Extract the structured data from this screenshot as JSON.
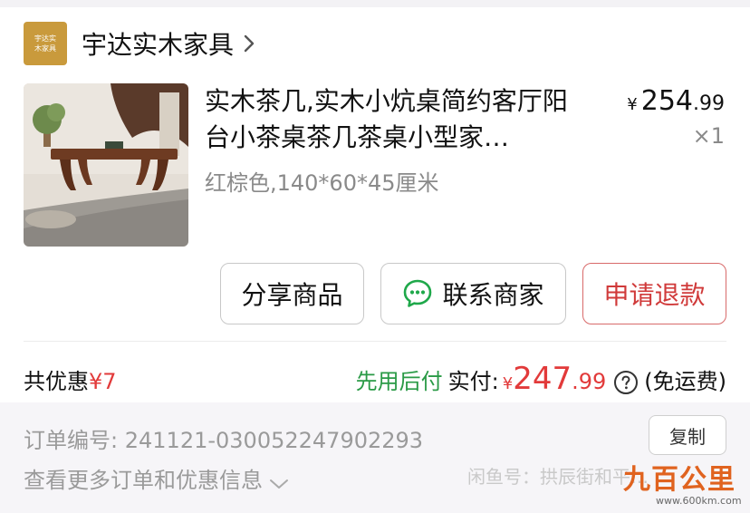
{
  "shop": {
    "logo_line1": "宇达实",
    "logo_line2": "木家具",
    "name": "宇达实木家具",
    "chevron_icon": "chevron-right-icon"
  },
  "product": {
    "title": "实木茶几,实木小炕桌简约客厅阳台小茶桌茶几茶桌小型家…",
    "spec": "红棕色,140*60*45厘米",
    "price_symbol": "¥",
    "price_int": "254",
    "price_dec": ".99",
    "quantity": "×1"
  },
  "actions": {
    "share": "分享商品",
    "contact": "联系商家",
    "contact_icon": "chat-bubble-icon",
    "refund": "申请退款"
  },
  "summary": {
    "discount_label": "共优惠",
    "discount_value": "¥7",
    "pay_later": "先用后付",
    "paid_label": "实付:",
    "paid_symbol": "¥",
    "paid_int": "247",
    "paid_dec": ".99",
    "help_icon": "question-circle-icon",
    "shipping": "(免运费)"
  },
  "order": {
    "number_label": "订单编号:",
    "number_value": "241121-030052247902293",
    "more": "查看更多订单和优惠信息",
    "copy": "复制"
  },
  "overlay": {
    "watermark": "闲鱼号：拱辰街和平…",
    "brand_name": "九百公里",
    "brand_url": "www.600km.com"
  },
  "colors": {
    "accent_red": "#e23a3a",
    "pay_later_green": "#2a9a46",
    "refund_border": "#d86a6a",
    "logo_gold": "#c99a3c"
  }
}
